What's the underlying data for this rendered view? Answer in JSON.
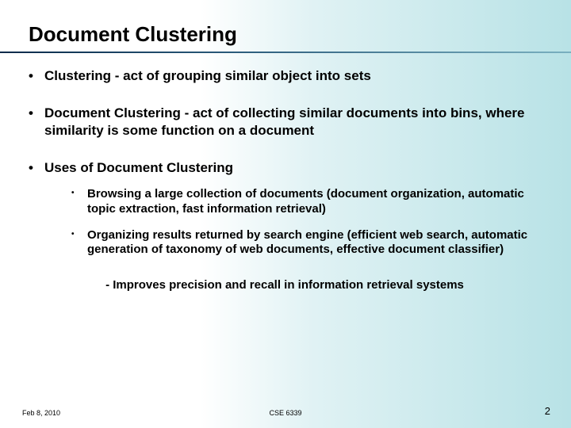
{
  "title": "Document Clustering",
  "bullets": {
    "b1": "Clustering - act of grouping similar object into sets",
    "b2": "Document Clustering - act of collecting similar documents into bins, where similarity is some function on a document",
    "b3": "Uses of Document Clustering",
    "sub": {
      "s1": "Browsing a large collection of documents (document organization, automatic topic extraction, fast information retrieval)",
      "s2": "Organizing results returned by  search engine (efficient web search, automatic generation of taxonomy of web documents, effective document classifier)"
    }
  },
  "note": "- Improves precision and recall in information retrieval systems",
  "footer": {
    "date": "Feb 8, 2010",
    "course": "CSE 6339",
    "page": "2"
  }
}
